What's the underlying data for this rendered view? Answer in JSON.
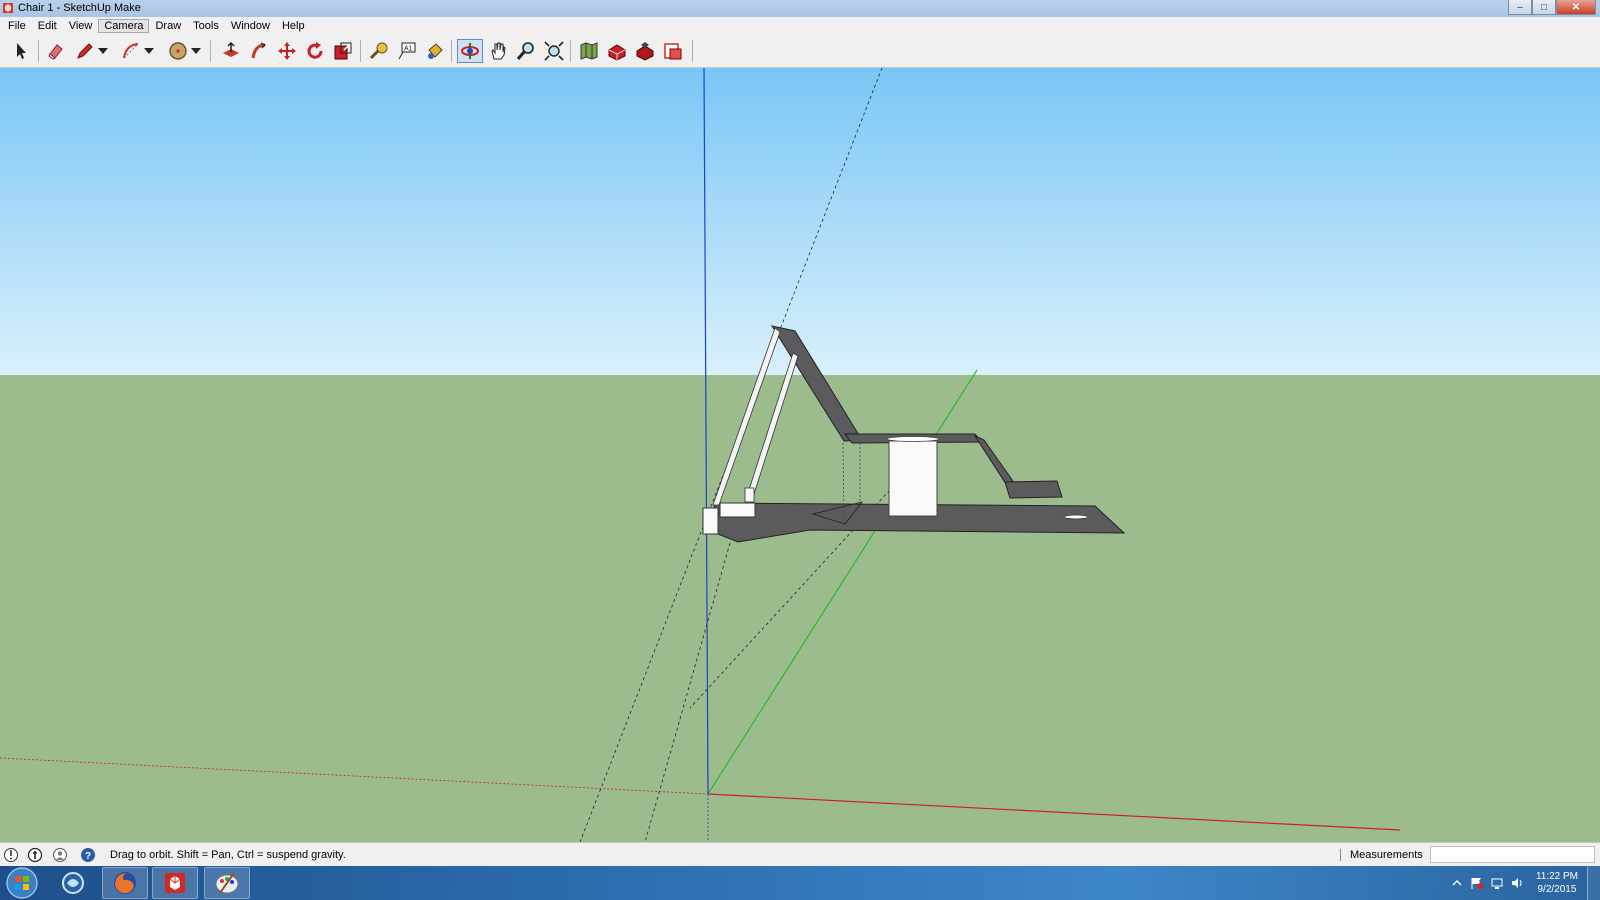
{
  "window": {
    "title": "Chair 1 - SketchUp Make",
    "icon": "sketchup-icon",
    "controls": [
      "minimize-icon",
      "maximize-icon",
      "close-icon"
    ]
  },
  "menubar": {
    "items": [
      "File",
      "Edit",
      "View",
      "Camera",
      "Draw",
      "Tools",
      "Window",
      "Help"
    ],
    "active": "Camera"
  },
  "toolbar": {
    "tools": [
      {
        "name": "select-tool",
        "icon": "arrow-icon"
      },
      {
        "name": "eraser-tool",
        "icon": "eraser-icon"
      },
      {
        "name": "line-tool",
        "icon": "pencil-icon"
      },
      {
        "name": "arc-tool",
        "icon": "arc-icon"
      },
      {
        "name": "shape-tool",
        "icon": "circle-icon"
      },
      {
        "name": "push-pull-tool",
        "icon": "pushpull-icon"
      },
      {
        "name": "offset-tool",
        "icon": "followme-icon"
      },
      {
        "name": "move-tool",
        "icon": "move-icon"
      },
      {
        "name": "rotate-tool",
        "icon": "rotate-icon"
      },
      {
        "name": "scale-tool",
        "icon": "scale-icon"
      },
      {
        "name": "tape-measure-tool",
        "icon": "tape-measure-icon"
      },
      {
        "name": "text-tool",
        "icon": "text-icon"
      },
      {
        "name": "paint-bucket-tool",
        "icon": "paint-bucket-icon"
      },
      {
        "name": "orbit-tool",
        "icon": "orbit-icon",
        "active": true
      },
      {
        "name": "pan-tool",
        "icon": "hand-icon"
      },
      {
        "name": "zoom-tool",
        "icon": "zoom-icon"
      },
      {
        "name": "zoom-extents-tool",
        "icon": "zoom-extents-icon"
      },
      {
        "name": "add-location-tool",
        "icon": "map-icon"
      },
      {
        "name": "warehouse-tool",
        "icon": "warehouse-icon"
      },
      {
        "name": "extension-warehouse-tool",
        "icon": "extension-icon"
      },
      {
        "name": "share-model-tool",
        "icon": "layout-icon"
      }
    ]
  },
  "colors": {
    "sky_top": "#79c6f6",
    "sky_bottom": "#d9f0fb",
    "ground": "#9cbc8e",
    "model_face": "#5b5b5e",
    "axis_red": "#cc2020",
    "axis_green": "#2eb82e",
    "axis_blue": "#1f3fd0"
  },
  "statusbar": {
    "icons": [
      "geo-location-icon",
      "credits-icon",
      "user-account-icon",
      "help-icon"
    ],
    "hint": "Drag to orbit. Shift = Pan, Ctrl = suspend gravity.",
    "measurements_label": "Measurements",
    "measurements_value": ""
  },
  "taskbar": {
    "apps": [
      "windows-start-icon",
      "file-manager-icon",
      "firefox-icon",
      "sketchup-icon",
      "paint-icon"
    ],
    "clock_time": "11:22 PM",
    "clock_date": "9/2/2015"
  }
}
